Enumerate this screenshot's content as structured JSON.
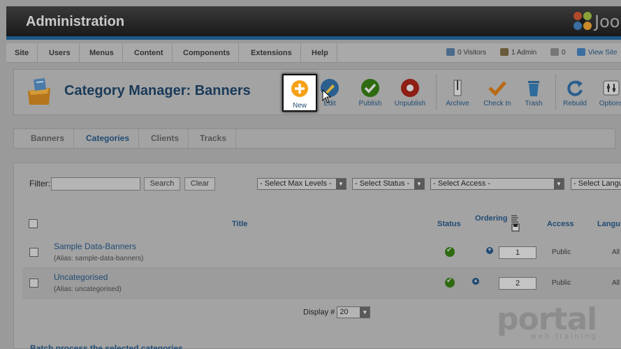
{
  "header": {
    "title": "Administration",
    "logo_text": "Joo"
  },
  "menu": [
    "Site",
    "Users",
    "Menus",
    "Content",
    "Components",
    "Extensions",
    "Help"
  ],
  "status": {
    "visitors": "0 Visitors",
    "admins": "1 Admin",
    "messages": "0",
    "view_site": "View Site"
  },
  "page": {
    "title": "Category Manager: Banners"
  },
  "toolbar": {
    "new": "New",
    "edit": "Edit",
    "publish": "Publish",
    "unpublish": "Unpublish",
    "archive": "Archive",
    "checkin": "Check In",
    "trash": "Trash",
    "rebuild": "Rebuild",
    "options": "Options"
  },
  "tabs": [
    "Banners",
    "Categories",
    "Clients",
    "Tracks"
  ],
  "filter": {
    "label": "Filter:",
    "value": "",
    "search": "Search",
    "clear": "Clear",
    "max_levels": "- Select Max Levels -",
    "status": "- Select Status -",
    "access": "- Select Access -",
    "language": "- Select Language -"
  },
  "table": {
    "headers": {
      "title": "Title",
      "status": "Status",
      "ordering": "Ordering",
      "access": "Access",
      "language": "Langu"
    },
    "rows": [
      {
        "title": "Sample Data-Banners",
        "alias": "(Alias: sample-data-banners)",
        "order": "1",
        "access": "Public",
        "language": "All"
      },
      {
        "title": "Uncategorised",
        "alias": "(Alias: uncategorised)",
        "order": "2",
        "access": "Public",
        "language": "All"
      }
    ]
  },
  "display": {
    "label": "Display #",
    "value": "20"
  },
  "batch": {
    "title": "Batch process the selected categories"
  },
  "watermark": {
    "text": "portal",
    "sub": "web training"
  }
}
